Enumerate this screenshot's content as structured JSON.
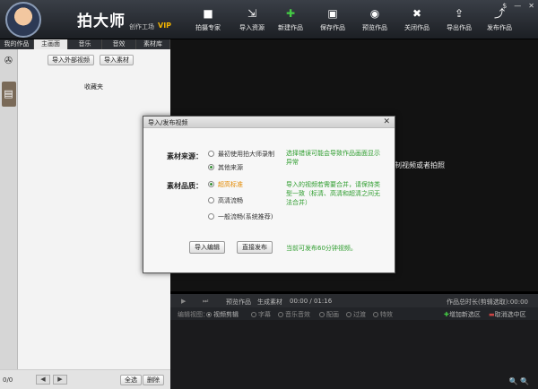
{
  "app": {
    "title": "拍大师",
    "subtitle": "创作工场",
    "vip": "VIP"
  },
  "toolbar": [
    {
      "icon": "camera-icon",
      "label": "拍摄专家"
    },
    {
      "icon": "import-icon",
      "label": "导入资源"
    },
    {
      "icon": "new-icon",
      "label": "新建作品"
    },
    {
      "icon": "save-icon",
      "label": "保存作品"
    },
    {
      "icon": "eye-icon",
      "label": "预览作品"
    },
    {
      "icon": "close-doc-icon",
      "label": "关闭作品"
    },
    {
      "icon": "export-icon",
      "label": "导出作品"
    },
    {
      "icon": "publish-icon",
      "label": "发布作品"
    }
  ],
  "window_buttons": [
    "$",
    "—",
    "✕"
  ],
  "left_tabs": [
    "我的作品",
    "主画面",
    "音乐",
    "音效",
    "素材库"
  ],
  "left_active_tab": 1,
  "left": {
    "import_external": "导入外部视频",
    "import_material": "导入素材",
    "favorites": "收藏夹",
    "page_count": "0/0",
    "select_all": "全选",
    "delete": "删除"
  },
  "preview_hint": "制视频或者拍照",
  "controls": {
    "preview": "预览作品",
    "generate": "生成素材",
    "time": "00:00 / 01:16",
    "duration": "作品总时长(剪辑选取):00:00"
  },
  "edit_view": {
    "label": "编辑视图：",
    "options": [
      "视频剪辑",
      "字幕",
      "音乐音效",
      "配画",
      "过渡",
      "特效"
    ],
    "add_segment": "增加新选区",
    "cancel_segment": "取消选中区"
  },
  "dialog": {
    "title": "导入/发布视频",
    "source_label": "素材来源：",
    "source_options": [
      "最初使用拍大师录制",
      "其他来源"
    ],
    "source_selected": 1,
    "source_note": "选择错误可能会导致作品画面显示异常",
    "quality_label": "素材品质：",
    "quality_options": [
      "超高标准",
      "高清流畅",
      "一般流畅(系统推荐)"
    ],
    "quality_selected": 0,
    "quality_note": "导入的视频若需要合并，请保持类型一致（标清、高清和超清之间无法合并）",
    "import_edit": "导入编辑",
    "direct_publish": "直接发布",
    "publish_note": "当前可发布60分钟视频。"
  }
}
